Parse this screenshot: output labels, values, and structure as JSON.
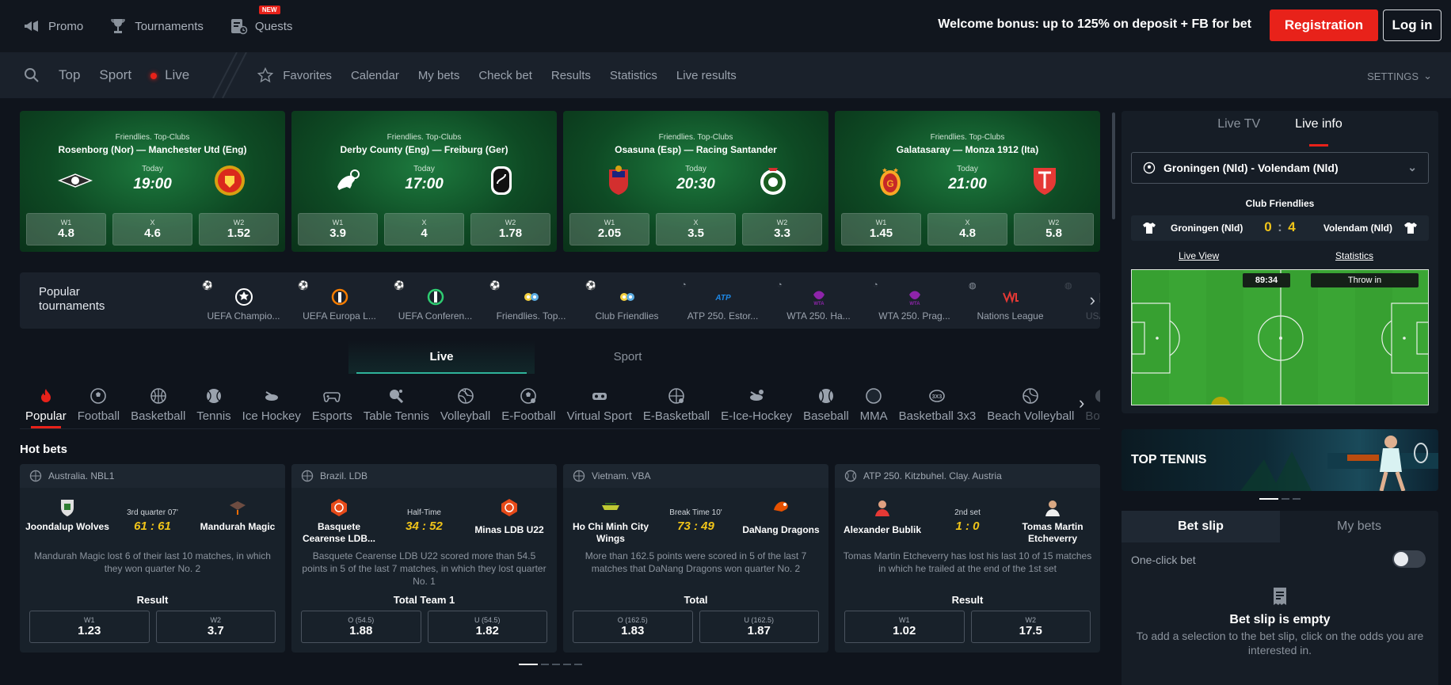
{
  "topnav": {
    "promo": "Promo",
    "tournaments": "Tournaments",
    "quests": "Quests",
    "quests_badge": "NEW"
  },
  "header": {
    "welcome": "Welcome bonus: up to 125% on deposit + FB for bet",
    "registration": "Registration",
    "login": "Log in"
  },
  "secnav": {
    "top": "Top",
    "sport": "Sport",
    "live": "Live",
    "favorites": "Favorites",
    "calendar": "Calendar",
    "my_bets": "My bets",
    "check_bet": "Check bet",
    "results": "Results",
    "statistics": "Statistics",
    "live_results": "Live results",
    "settings": "SETTINGS"
  },
  "featured": [
    {
      "league": "Friendlies. Top-Clubs",
      "team1": "Rosenborg (Nor)",
      "team2": "Manchester Utd (Eng)",
      "day": "Today",
      "time": "19:00",
      "odds": [
        {
          "label": "W1",
          "value": "4.8"
        },
        {
          "label": "X",
          "value": "4.6"
        },
        {
          "label": "W2",
          "value": "1.52"
        }
      ]
    },
    {
      "league": "Friendlies. Top-Clubs",
      "team1": "Derby County (Eng)",
      "team2": "Freiburg (Ger)",
      "day": "Today",
      "time": "17:00",
      "odds": [
        {
          "label": "W1",
          "value": "3.9"
        },
        {
          "label": "X",
          "value": "4"
        },
        {
          "label": "W2",
          "value": "1.78"
        }
      ]
    },
    {
      "league": "Friendlies. Top-Clubs",
      "team1": "Osasuna (Esp)",
      "team2": "Racing Santander",
      "day": "Today",
      "time": "20:30",
      "odds": [
        {
          "label": "W1",
          "value": "2.05"
        },
        {
          "label": "X",
          "value": "3.5"
        },
        {
          "label": "W2",
          "value": "3.3"
        }
      ]
    },
    {
      "label_note": "",
      "league": "Friendlies. Top-Clubs",
      "team1": "Galatasaray",
      "team2": "Monza 1912 (Ita)",
      "day": "Today",
      "time": "21:00",
      "odds": [
        {
          "label": "W1",
          "value": "1.45"
        },
        {
          "label": "X",
          "value": "4.8"
        },
        {
          "label": "W2",
          "value": "5.8"
        }
      ]
    }
  ],
  "popular": {
    "title": "Popular tournaments",
    "items": [
      {
        "name": "UEFA Champio...",
        "icon": "champions-league-icon"
      },
      {
        "name": "UEFA Europa L...",
        "icon": "europa-league-icon"
      },
      {
        "name": "UEFA Conferen...",
        "icon": "conference-league-icon"
      },
      {
        "name": "Friendlies. Top...",
        "icon": "friendlies-icon"
      },
      {
        "name": "Club Friendlies",
        "icon": "club-friendlies-icon"
      },
      {
        "name": "ATP 250. Estor...",
        "icon": "atp-icon"
      },
      {
        "name": "WTA 250. Ha...",
        "icon": "wta-icon"
      },
      {
        "name": "WTA 250. Prag...",
        "icon": "wta-icon"
      },
      {
        "name": "Nations League",
        "icon": "vnl-icon"
      },
      {
        "name": "USA. M...",
        "icon": "usa-icon"
      }
    ]
  },
  "mode_tabs": {
    "live": "Live",
    "sport": "Sport"
  },
  "sports": [
    "Popular",
    "Football",
    "Basketball",
    "Tennis",
    "Ice Hockey",
    "Esports",
    "Table Tennis",
    "Volleyball",
    "E-Football",
    "Virtual Sport",
    "E-Basketball",
    "E-Ice-Hockey",
    "Baseball",
    "MMA",
    "Basketball 3x3",
    "Beach Volleyball",
    "Bow..."
  ],
  "hot": {
    "title": "Hot bets",
    "cards": [
      {
        "league": "Australia. NBL1",
        "team1": "Joondalup Wolves",
        "team2": "Mandurah Magic",
        "status": "3rd quarter 07'",
        "score": "61 : 61",
        "desc": "Mandurah Magic lost 6 of their last 10 matches, in which they won quarter No. 2",
        "market": "Result",
        "odds": [
          {
            "label": "W1",
            "value": "1.23"
          },
          {
            "label": "W2",
            "value": "3.7"
          }
        ]
      },
      {
        "league": "Brazil. LDB",
        "team1": "Basquete Cearense LDB...",
        "team2": "Minas LDB U22",
        "status": "Half-Time",
        "score": "34 : 52",
        "desc": "Basquete Cearense LDB U22 scored more than 54.5 points in 5 of the last 7 matches, in which they lost quarter No. 1",
        "market": "Total Team 1",
        "odds": [
          {
            "label": "O (54.5)",
            "value": "1.88"
          },
          {
            "label": "U (54.5)",
            "value": "1.82"
          }
        ]
      },
      {
        "league": "Vietnam. VBA",
        "team1": "Ho Chi Minh City Wings",
        "team2": "DaNang Dragons",
        "status": "Break Time 10'",
        "score": "73 : 49",
        "desc": "More than 162.5 points were scored in 5 of the last 7 matches that DaNang Dragons won quarter No. 2",
        "market": "Total",
        "odds": [
          {
            "label": "O (162.5)",
            "value": "1.83"
          },
          {
            "label": "U (162.5)",
            "value": "1.87"
          }
        ]
      },
      {
        "league": "ATP 250. Kitzbuhel. Clay. Austria",
        "team1": "Alexander Bublik",
        "team2": "Tomas Martin Etcheverry",
        "status": "2nd set",
        "score": "1 : 0",
        "desc": "Tomas Martin Etcheverry has lost his last 10 of 15 matches in which he trailed at the end of the 1st set",
        "market": "Result",
        "odds": [
          {
            "label": "W1",
            "value": "1.02"
          },
          {
            "label": "W2",
            "value": "17.5"
          }
        ]
      }
    ]
  },
  "live_panel": {
    "tab_tv": "Live TV",
    "tab_info": "Live info",
    "match_select": "Groningen (Nld) - Volendam (Nld)",
    "competition": "Club Friendlies",
    "team1": "Groningen (Nld)",
    "team2": "Volendam (Nld)",
    "score1": "0",
    "score2": "4",
    "live_view": "Live View",
    "statistics": "Statistics",
    "timer": "89:34",
    "event": "Throw in"
  },
  "banner": {
    "title": "TOP TENNIS"
  },
  "betslip": {
    "tab_slip": "Bet slip",
    "tab_mybets": "My bets",
    "one_click": "One-click bet",
    "empty_title": "Bet slip is empty",
    "empty_desc": "To add a selection to the bet slip, click on the odds you are interested in."
  },
  "colors": {
    "accent": "#e8221a",
    "score": "#f0c419",
    "background": "#0f141c"
  }
}
